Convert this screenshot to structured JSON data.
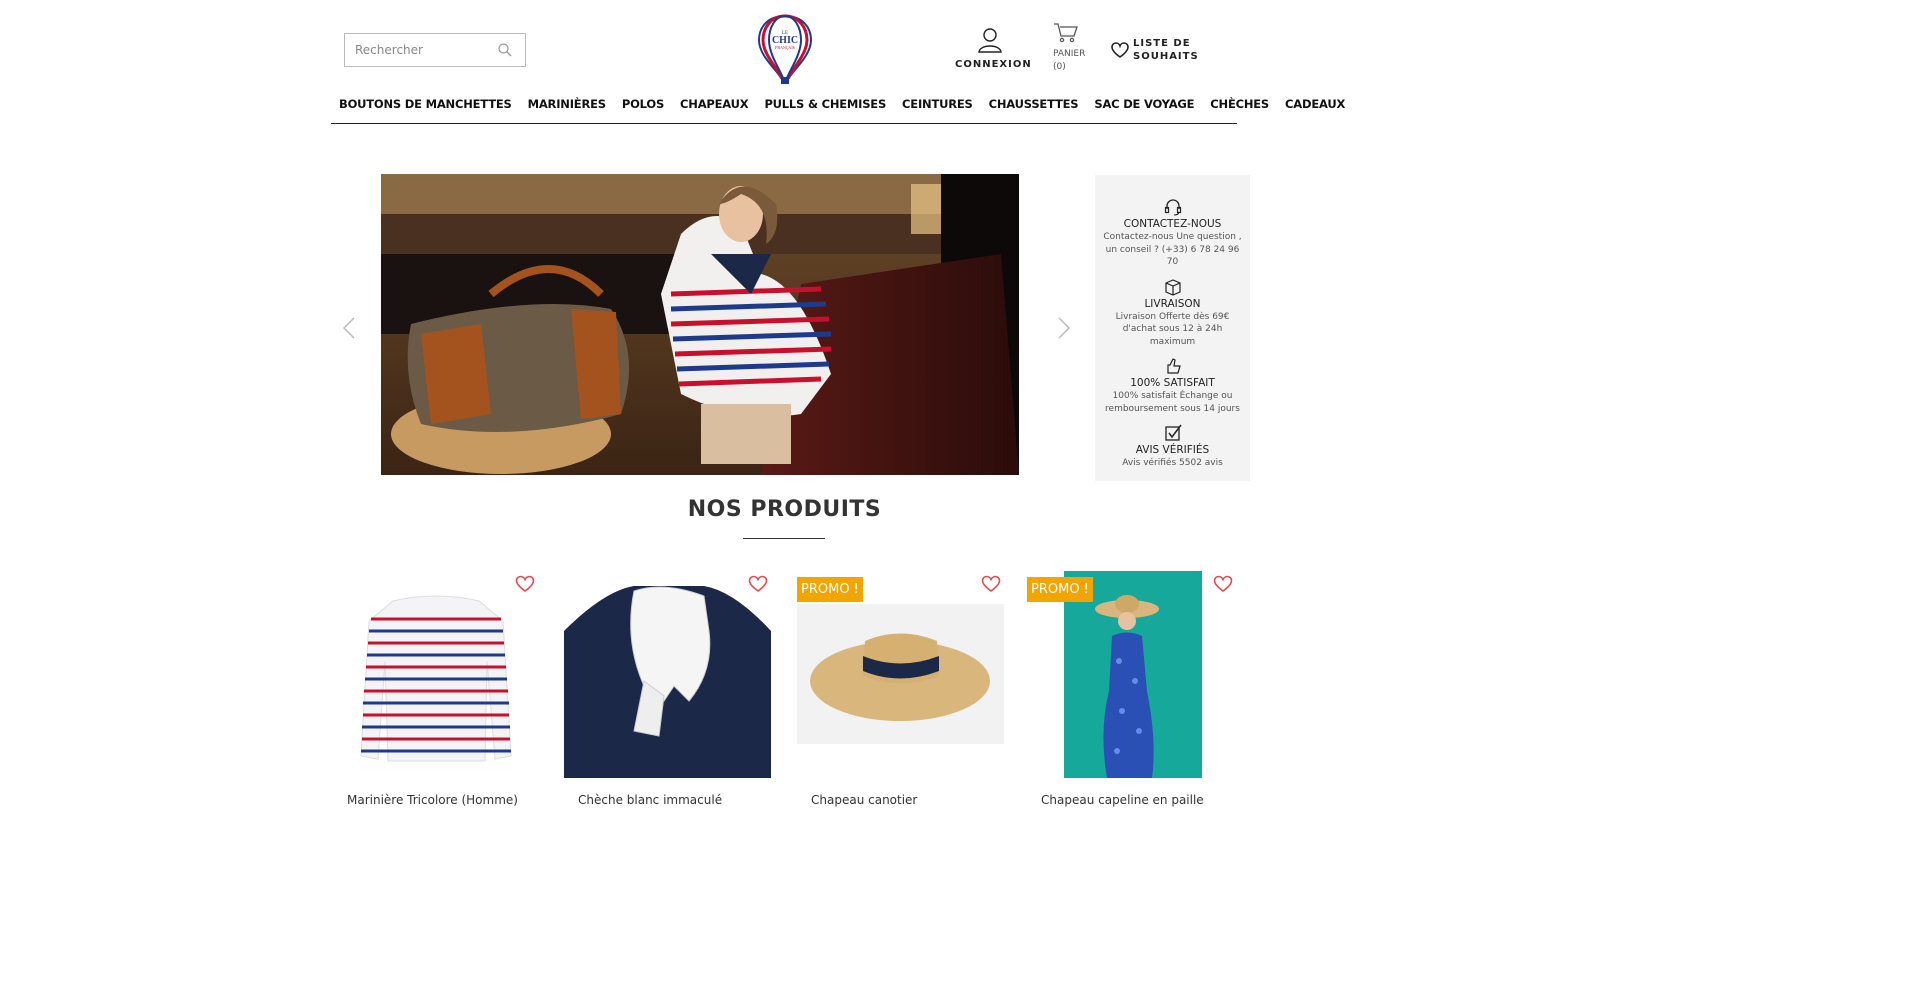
{
  "header": {
    "search_placeholder": "Rechercher",
    "logo_text": [
      "LE",
      "CHIC",
      "FRANÇAIS"
    ],
    "account_label": "CONNEXION",
    "cart_label": "PANIER",
    "cart_count": "(0)",
    "wishlist_label": "LISTE DE SOUHAITS"
  },
  "nav": {
    "items": [
      "BOUTONS DE MANCHETTES",
      "MARINIÈRES",
      "POLOS",
      "CHAPEAUX",
      "PULLS & CHEMISES",
      "CEINTURES",
      "CHAUSSETTES",
      "SAC DE VOYAGE",
      "CHÈCHES",
      "CADEAUX"
    ]
  },
  "reassurance": [
    {
      "icon": "headset-icon",
      "title": "CONTACTEZ-NOUS",
      "desc": "Contactez-nous Une question , un conseil ? (+33) 6 78 24 96 70"
    },
    {
      "icon": "box-icon",
      "title": "LIVRAISON",
      "desc": "Livraison Offerte dès 69€ d'achat sous 12 à 24h maximum"
    },
    {
      "icon": "thumbs-up-icon",
      "title": "100% SATISFAIT",
      "desc": "100% satisfait Échange ou remboursement sous 14 jours"
    },
    {
      "icon": "checkbox-icon",
      "title": "AVIS VÉRIFIÉS",
      "desc": "Avis vérifiés 5502 avis"
    }
  ],
  "products_section": {
    "title": "NOS PRODUITS",
    "items": [
      {
        "name": "Marinière Tricolore (Homme)",
        "promo": null
      },
      {
        "name": "Chèche blanc immaculé",
        "promo": null
      },
      {
        "name": "Chapeau canotier",
        "promo": "PROMO !"
      },
      {
        "name": "Chapeau capeline en paille",
        "promo": "PROMO !"
      }
    ]
  },
  "colors": {
    "promo": "#f0a500",
    "heart": "#e5484d",
    "navy": "#1c2847",
    "flag_red": "#c8102e",
    "flag_blue": "#1e3a8a"
  }
}
